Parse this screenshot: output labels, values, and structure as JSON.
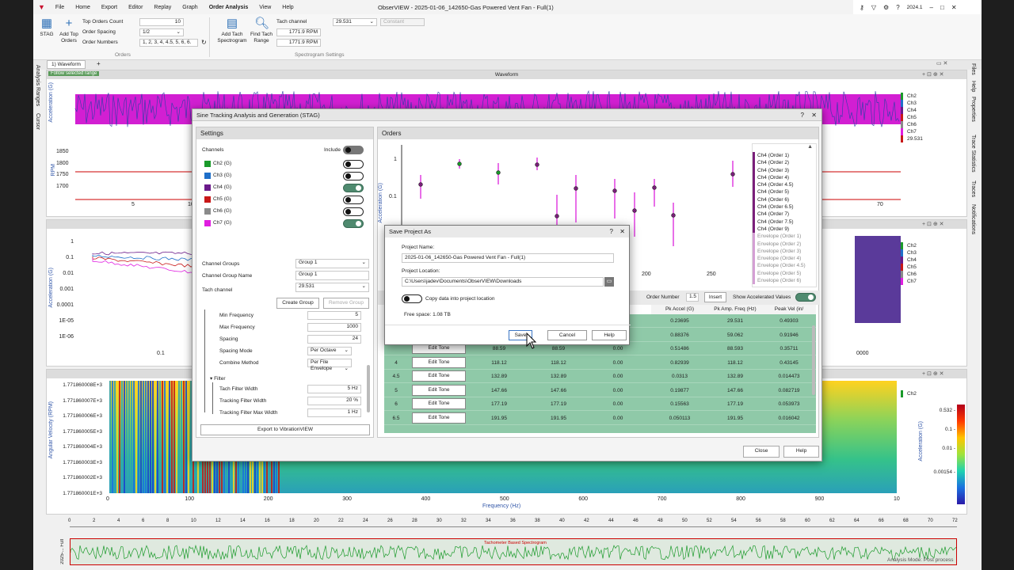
{
  "window": {
    "title": "ObserVIEW - 2025-01-06_142650-Gas Powered Vent Fan - Full(1)",
    "version": "2024.1"
  },
  "menu": [
    "File",
    "Home",
    "Export",
    "Editor",
    "Replay",
    "Graph",
    "Order Analysis",
    "View",
    "Help"
  ],
  "ribbon": {
    "stag": "STAG",
    "add_top_orders": "Add Top Orders",
    "top_orders_count_label": "Top Orders Count",
    "top_orders_count": "10",
    "order_spacing_label": "Order Spacing",
    "order_spacing": "1/2",
    "order_numbers_label": "Order Numbers",
    "order_numbers": "1, 2, 3, 4, 4.5, 5, 6, 6.",
    "group_orders": "Orders",
    "add_tach_spectrogram": "Add Tach Spectrogram",
    "find_tach_range": "Find Tach Range",
    "tach_channel_label": "Tach channel",
    "tach_channel": "29.531",
    "tach_mode": "Constant",
    "rpm1": "1771.9 RPM",
    "rpm2": "1771.9 RPM",
    "group_spectrogram": "Spectrogram Settings"
  },
  "doc_tab": "1) Waveform",
  "follow": "Follow selected range",
  "waveform_title": "Waveform",
  "waveform_ylabel": "Acceleration (G)",
  "rpm_ylabel": "RPM",
  "rpm_ticks": [
    "1850",
    "1800",
    "1750",
    "1700"
  ],
  "time_ticks": [
    "5",
    "10",
    "70"
  ],
  "channels_legend": [
    "Ch2",
    "Ch3",
    "Ch4",
    "Ch5",
    "Ch6",
    "Ch7",
    "29.531"
  ],
  "spectrum_ticks": [
    "1",
    "0.1",
    "0.01",
    "0.001",
    "0.0001",
    "1E-05",
    "1E-06"
  ],
  "spectrum_xtick": "0.1",
  "spectrum_xtick_right": "0000",
  "spectrogram_ylabel": "Angular Velocity (RPM)",
  "spectrogram_yticks": [
    "1.771860008E+3",
    "1.771860007E+3",
    "1.771860006E+3",
    "1.771860005E+3",
    "1.771860004E+3",
    "1.771860003E+3",
    "1.771860002E+3",
    "1.771860001E+3"
  ],
  "spectrogram_xticks": [
    "0",
    "100",
    "200",
    "300",
    "400",
    "500",
    "600",
    "700",
    "800",
    "900",
    "10"
  ],
  "spectrogram_xlabel": "Frequency (Hz)",
  "colorbar_ticks": [
    "0.532 -",
    "0.1 -",
    "0.01 -",
    "0.00154 -"
  ],
  "colorbar_label": "Acceleration (G)",
  "colorbar_channel": "Ch2",
  "timeline_ticks": [
    "0",
    "2",
    "4",
    "6",
    "8",
    "10",
    "12",
    "14",
    "16",
    "18",
    "20",
    "22",
    "24",
    "26",
    "28",
    "30",
    "32",
    "34",
    "36",
    "38",
    "40",
    "42",
    "44",
    "46",
    "48",
    "50",
    "52",
    "54",
    "56",
    "58",
    "60",
    "62",
    "64",
    "66",
    "68",
    "70",
    "72"
  ],
  "timeline_label": "Tachometer Based Spectrogram",
  "timeline_side": "2025-... Full",
  "status": "Analysis Mode: Post process",
  "side_tabs": [
    "Analysis Ranges",
    "Cursor"
  ],
  "right_tabs": [
    "Files",
    "Help",
    "Properties",
    "Trace Statistics",
    "Traces",
    "Notifications"
  ],
  "stag": {
    "title": "Sine Tracking Analysis and Generation (STAG)",
    "settings_header": "Settings",
    "channels_label": "Channels",
    "include_label": "Include",
    "channels": [
      {
        "name": "Ch2 (G)",
        "color": "#1a9a2a",
        "on": false
      },
      {
        "name": "Ch3 (G)",
        "color": "#1f6fc9",
        "on": false
      },
      {
        "name": "Ch4 (G)",
        "color": "#6a1a8a",
        "on": true
      },
      {
        "name": "Ch5 (G)",
        "color": "#c81818",
        "on": false
      },
      {
        "name": "Ch6 (G)",
        "color": "#8a8a8a",
        "on": false
      },
      {
        "name": "Ch7 (G)",
        "color": "#e01ee0",
        "on": true
      }
    ],
    "channel_groups_label": "Channel Groups",
    "channel_groups": "Group 1",
    "channel_group_name_label": "Channel Group Name",
    "channel_group_name": "Group 1",
    "tach_channel_label": "Tach channel",
    "tach_channel": "29.531",
    "create_group": "Create Group",
    "remove_group": "Remove Group",
    "params": [
      {
        "label": "Min Frequency",
        "value": "5"
      },
      {
        "label": "Max Frequency",
        "value": "1000"
      },
      {
        "label": "Spacing",
        "value": "24"
      },
      {
        "label": "Spacing Mode",
        "value": "Per Octave"
      },
      {
        "label": "Combine Method",
        "value": "Per File Envelope"
      }
    ],
    "filter_label": "Filter",
    "filter_params": [
      {
        "label": "Tach Filter Width",
        "value": "5 Hz"
      },
      {
        "label": "Tracking Filter Width",
        "value": "20 %"
      },
      {
        "label": "Tracking Filter Max Width",
        "value": "1 Hz"
      }
    ],
    "export_button": "Export to VibrationVIEW",
    "orders_header": "Orders",
    "orders_ylabel": "Acceleration (G)",
    "orders_yticks": [
      "1",
      "0.1"
    ],
    "orders_xticks": [
      "200",
      "250"
    ],
    "legend": [
      "Ch4 (Order 1)",
      "Ch4 (Order 2)",
      "Ch4 (Order 3)",
      "Ch4 (Order 4)",
      "Ch4 (Order 4.5)",
      "Ch4 (Order 5)",
      "Ch4 (Order 6)",
      "Ch4 (Order 6.5)",
      "Ch4 (Order 7)",
      "Ch4 (Order 7.5)",
      "Ch4 (Order 9)",
      "Envelope (Order 1)",
      "Envelope (Order 2)",
      "Envelope (Order 3)",
      "Envelope (Order 4)",
      "Envelope (Order 4.5)",
      "Envelope (Order 5)",
      "Envelope (Order 6)"
    ],
    "order_number_label": "Order Number",
    "order_number": "1.5",
    "insert": "Insert",
    "show_accel_label": "Show Accelerated Values",
    "columns": [
      "Pk Accel (G)",
      "Pk Amp. Freq (Hz)",
      "Peak Vel (in/"
    ],
    "edit_tone": "Edit Tone",
    "rows": [
      {
        "order": "",
        "c2": "",
        "c3": "",
        "c4": "",
        "accel": "0.23695",
        "freq": "29.531",
        "vel": "0.49303"
      },
      {
        "order": "",
        "c2": "",
        "c3": "",
        "c4": "",
        "accel": "0.88376",
        "freq": "59.062",
        "vel": "0.91946"
      },
      {
        "order": "",
        "c2": "88.59",
        "c3": "88.59",
        "c4": "0.00",
        "accel": "0.51486",
        "freq": "88.593",
        "vel": "0.35711"
      },
      {
        "order": "4",
        "c2": "118.12",
        "c3": "118.12",
        "c4": "0.00",
        "accel": "0.82939",
        "freq": "118.12",
        "vel": "0.43145"
      },
      {
        "order": "4.5",
        "c2": "132.89",
        "c3": "132.89",
        "c4": "0.00",
        "accel": "0.0313",
        "freq": "132.89",
        "vel": "0.014473"
      },
      {
        "order": "5",
        "c2": "147.66",
        "c3": "147.66",
        "c4": "0.00",
        "accel": "0.19877",
        "freq": "147.66",
        "vel": "0.082719"
      },
      {
        "order": "6",
        "c2": "177.19",
        "c3": "177.19",
        "c4": "0.00",
        "accel": "0.15563",
        "freq": "177.19",
        "vel": "0.053973"
      },
      {
        "order": "6.5",
        "c2": "191.95",
        "c3": "191.95",
        "c4": "0.00",
        "accel": "0.050113",
        "freq": "191.95",
        "vel": "0.016042"
      }
    ],
    "close": "Close",
    "help": "Help"
  },
  "save_dialog": {
    "title": "Save Project As",
    "name_label": "Project Name:",
    "name": "2025-01-06_142650-Gas Powered Vent Fan - Full(1)",
    "location_label": "Project Location:",
    "location": "C:\\Users\\jadev\\Documents\\ObserVIEW\\Downloads",
    "copy_label": "Copy data into project location",
    "free_space": "Free space: 1.08 TB",
    "save": "Save",
    "cancel": "Cancel",
    "help": "Help"
  }
}
